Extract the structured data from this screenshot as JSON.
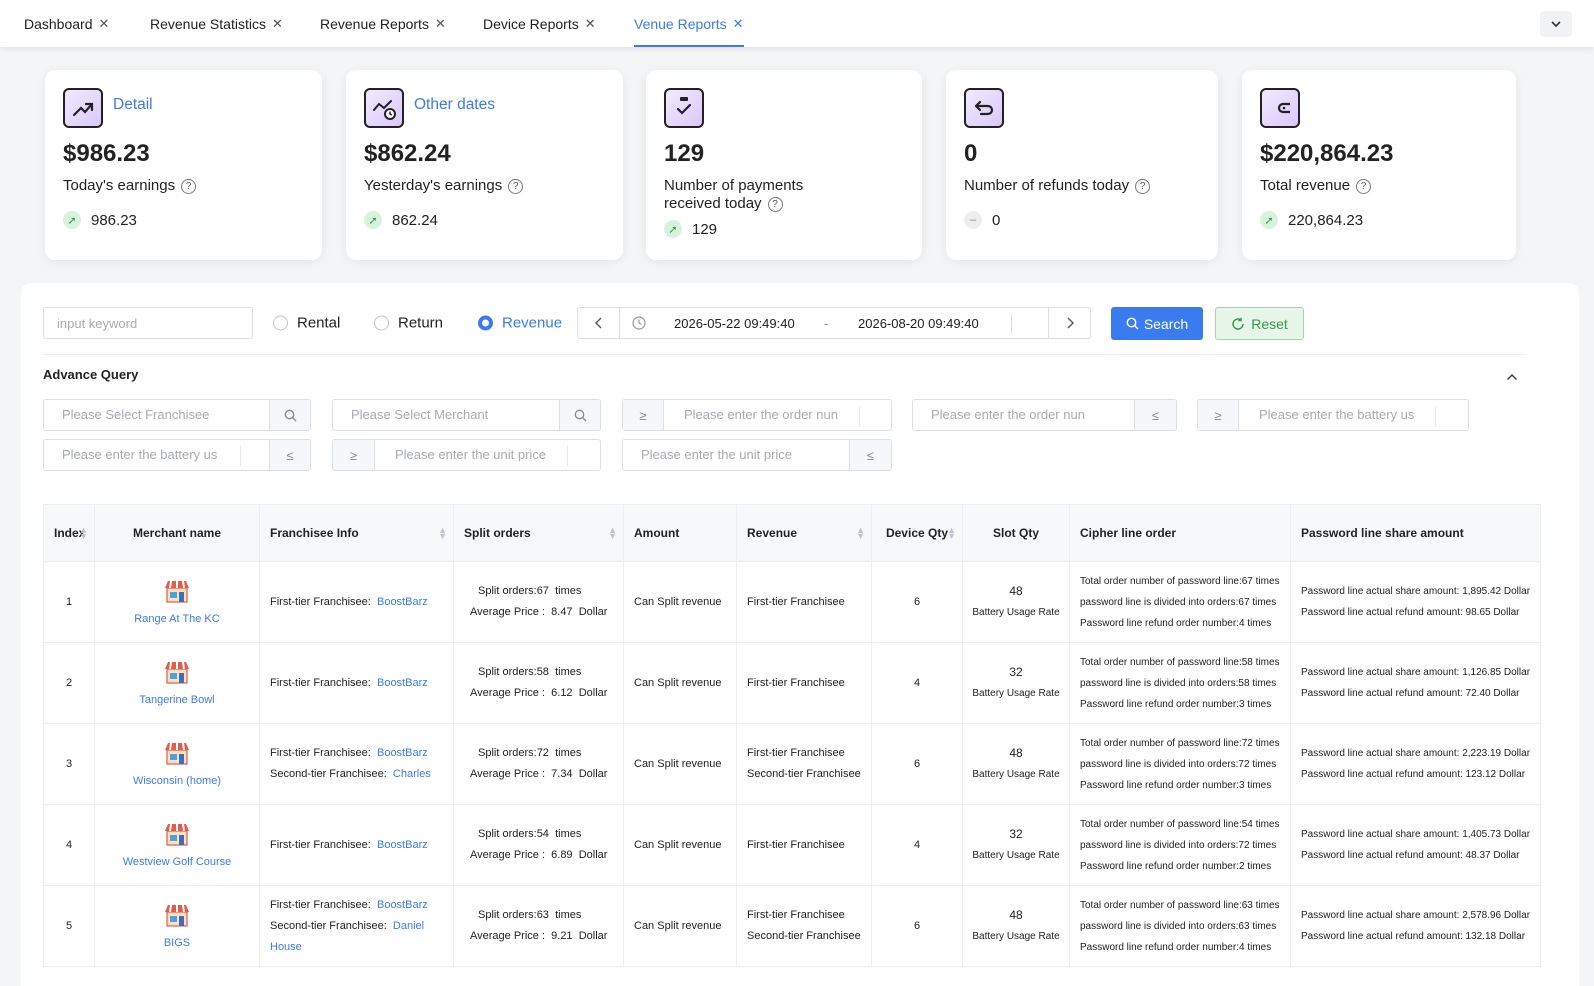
{
  "tabs": [
    {
      "label": "Dashboard"
    },
    {
      "label": "Revenue Statistics"
    },
    {
      "label": "Revenue Reports"
    },
    {
      "label": "Device Reports"
    },
    {
      "label": "Venue Reports"
    }
  ],
  "active_tab": "Venue Reports",
  "cards": [
    {
      "link": "Detail",
      "value": "$986.23",
      "label": "Today's earnings",
      "trend": "986.23",
      "icon": "trend-up-icon"
    },
    {
      "link": "Other dates",
      "value": "$862.24",
      "label": "Yesterday's earnings",
      "trend": "862.24",
      "icon": "chart-clock-icon"
    },
    {
      "link": "",
      "value": "129",
      "label": "Number of payments received today",
      "trend": "129",
      "icon": "clipboard-check-icon"
    },
    {
      "link": "",
      "value": "0",
      "label": "Number of refunds today",
      "trend": "0",
      "icon": "refund-icon"
    },
    {
      "link": "",
      "value": "$220,864.23",
      "label": "Total revenue",
      "trend": "220,864.23",
      "icon": "wallet-icon"
    }
  ],
  "filters": {
    "keyword_placeholder": "input keyword",
    "radios": [
      {
        "label": "Rental"
      },
      {
        "label": "Return"
      },
      {
        "label": "Revenue"
      }
    ],
    "selected_radio": "Revenue",
    "date_start": "2026-05-22 09:49:40",
    "date_sep": "-",
    "date_end": "2026-08-20 09:49:40",
    "search_label": "Search",
    "reset_label": "Reset"
  },
  "advance": {
    "title": "Advance Query",
    "fields": {
      "franchisee": "Please Select Franchisee",
      "merchant": "Please Select Merchant",
      "order_min": "Please enter the order nun",
      "order_max": "Please enter the order nun",
      "battery_min": "Please enter the battery us",
      "battery_max": "Please enter the battery us",
      "price_min": "Please enter the unit price",
      "price_max": "Please enter the unit price"
    },
    "ge": "≥",
    "le": "≤"
  },
  "table": {
    "headers": [
      "Index",
      "Merchant name",
      "Franchisee Info",
      "Split orders",
      "Amount",
      "Revenue",
      "Device Qty",
      "Slot Qty",
      "Cipher line order",
      "Password line share amount"
    ],
    "labels": {
      "first_tier": "First-tier Franchisee:",
      "second_tier": "Second-tier Franchisee:",
      "avg_price": "Average Price :",
      "dollar": "Dollar",
      "times": "times",
      "battery_rate": "Battery Usage Rate",
      "first_tier_rev": "First-tier Franchisee",
      "second_tier_rev": "Second-tier Franchisee"
    },
    "rows": [
      {
        "index": "1",
        "merchant": "Range At The KC",
        "first": "BoostBarz",
        "second": "",
        "split": "Split orders:67",
        "avg": "8.47",
        "amount": "Can Split revenue",
        "device": "6",
        "slot": "48",
        "c1": "Total order number of password line:67 times",
        "c2": "password line is divided into orders:67 times",
        "c3": "Password line refund order number:4 times",
        "p1": "Password line actual share amount: 1,895.42 Dollar",
        "p2": "Password line actual refund amount: 98.65 Dollar"
      },
      {
        "index": "2",
        "merchant": "Tangerine Bowl",
        "first": "BoostBarz",
        "second": "",
        "split": "Split orders:58",
        "avg": "6.12",
        "amount": "Can Split revenue",
        "device": "4",
        "slot": "32",
        "c1": "Total order number of password line:58 times",
        "c2": "password line is divided into orders:58 times",
        "c3": "Password line refund order number:3 times",
        "p1": "Password line actual share amount: 1,126.85 Dollar",
        "p2": "Password line actual refund amount: 72.40 Dollar"
      },
      {
        "index": "3",
        "merchant": "Wisconsin (home)",
        "first": "BoostBarz",
        "second": "Charles",
        "split": "Split orders:72",
        "avg": "7.34",
        "amount": "Can Split revenue",
        "device": "6",
        "slot": "48",
        "c1": "Total order number of password line:72 times",
        "c2": "password line is divided into orders:72 times",
        "c3": "Password line refund order number:3 times",
        "p1": "Password line actual share amount: 2,223.19 Dollar",
        "p2": "Password line actual refund amount: 123.12 Dollar"
      },
      {
        "index": "4",
        "merchant": "Westview Golf Course",
        "first": "BoostBarz",
        "second": "",
        "split": "Split orders:54",
        "avg": "6.89",
        "amount": "Can Split revenue",
        "device": "4",
        "slot": "32",
        "c1": "Total order number of password line:54 times",
        "c2": "password line is divided into orders:72 times",
        "c3": "Password line refund order number:2 times",
        "p1": "Password line actual share amount: 1,405.73 Dollar",
        "p2": "Password line actual refund amount: 48.37 Dollar"
      },
      {
        "index": "5",
        "merchant": "BIGS",
        "first": "BoostBarz",
        "second": "Daniel House",
        "split": "Split orders:63",
        "avg": "9.21",
        "amount": "Can Split revenue",
        "device": "6",
        "slot": "48",
        "c1": "Total order number of password line:63 times",
        "c2": "password line is divided into orders:63 times",
        "c3": "Password line refund order number:4 times",
        "p1": "Password line actual share amount: 2,578.96 Dollar",
        "p2": "Password line actual refund amount: 132.18 Dollar"
      }
    ]
  },
  "colors": {
    "accent": "#3a7bf0",
    "reset_bg": "#e8f6ea",
    "reset_border": "#9fd7a9",
    "reset_text": "#2e9b48"
  }
}
